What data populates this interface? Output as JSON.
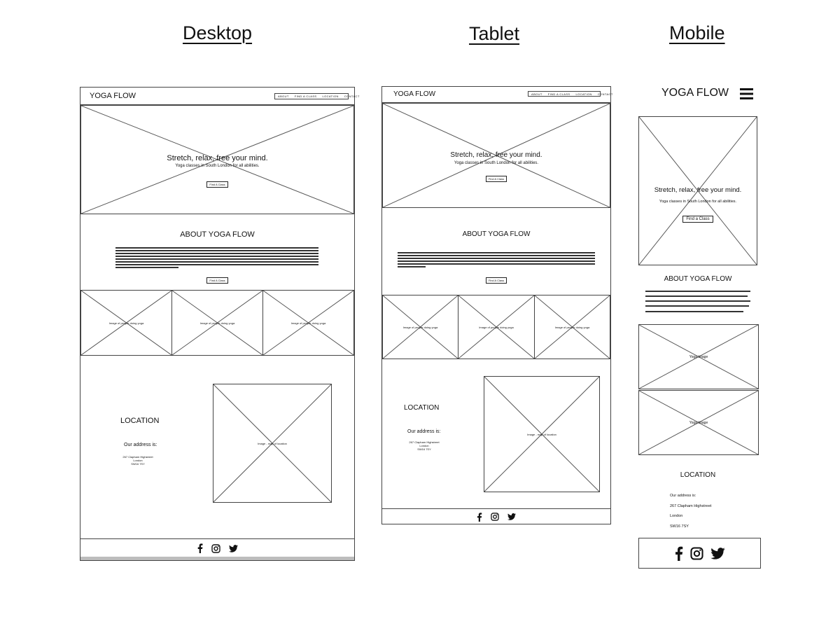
{
  "headings": {
    "desktop": "Desktop",
    "tablet": "Tablet",
    "mobile": "Mobile"
  },
  "brand": "YOGA FLOW",
  "nav": [
    "ABOUT",
    "FIND A CLASS",
    "LOCATION",
    "CONTACT"
  ],
  "hero": {
    "title": "Stretch, relax, free your mind.",
    "subtitle": "Yoga classes in South London for all abilities.",
    "cta": "Find A Class",
    "cta_mobile": "Find a Class"
  },
  "about": {
    "title": "ABOUT YOGA FLOW",
    "cta": "Find A Class"
  },
  "gallery": {
    "caption": "Image of people doing yoga",
    "mobile_caption": "Yoga Image"
  },
  "location": {
    "title": "LOCATION",
    "address_label": "Our address is:",
    "map_caption": "Image - map of location",
    "street": "267 Clapham Highstreet",
    "city": "London",
    "postcode": "SW16 7SY"
  },
  "icons": [
    "facebook-icon",
    "instagram-icon",
    "twitter-icon",
    "hamburger-menu-icon",
    "placeholder-x-icon"
  ]
}
